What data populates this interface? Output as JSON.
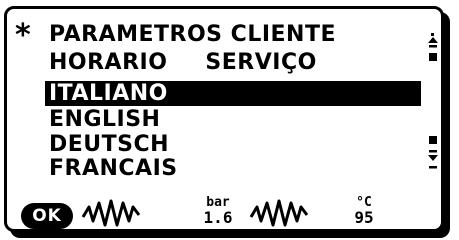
{
  "menu": {
    "marker": "*",
    "title": "PARAMETROS CLIENTE",
    "line2_left": "HORARIO",
    "line2_right": "SERVIÇO",
    "languages": [
      "ITALIANO",
      "ENGLISH",
      "DEUTSCH",
      "FRANCAIS"
    ],
    "selected_index": 0
  },
  "status_bar": {
    "ok_label": "OK",
    "pressure_unit": "bar",
    "pressure_value": "1.6",
    "temp_unit": "°C",
    "temp_value": "95",
    "icons": [
      "wave-icon",
      "wave-icon"
    ]
  },
  "colors": {
    "foreground": "#000000",
    "background": "#ffffff"
  }
}
